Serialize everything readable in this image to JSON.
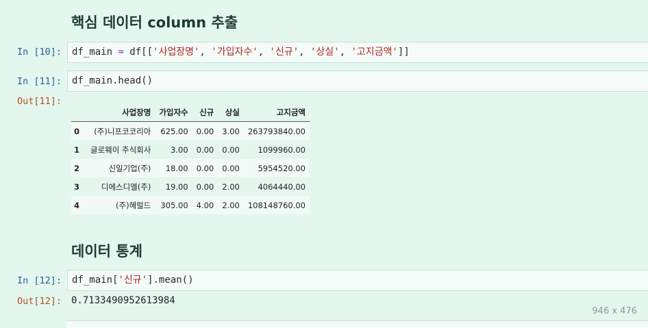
{
  "headings": {
    "extract": "핵심 데이터 column 추출",
    "stats": "데이터 통계"
  },
  "cells": [
    {
      "in_prompt": "In [10]:",
      "code_parts": [
        "df_main ",
        "=",
        " df[[",
        "'사업장명'",
        ", ",
        "'가입자수'",
        ", ",
        "'신규'",
        ", ",
        "'상실'",
        ", ",
        "'고지금액'",
        "]]"
      ]
    },
    {
      "in_prompt": "In [11]:",
      "code": "df_main.head()",
      "out_prompt": "Out[11]:"
    },
    {
      "in_prompt": "In [12]:",
      "code_parts": [
        "df_main[",
        "'신규'",
        "].mean()"
      ],
      "out_prompt": "Out[12]:",
      "output": "0.7133490952613984"
    }
  ],
  "dataframe": {
    "columns": [
      "",
      "사업장명",
      "가입자수",
      "신규",
      "상실",
      "고지금액"
    ],
    "rows": [
      [
        "0",
        "(주)니프코코리아",
        "625.00",
        "0.00",
        "3.00",
        "263793840.00"
      ],
      [
        "1",
        "글로웨이 주식회사",
        "3.00",
        "0.00",
        "0.00",
        "1099960.00"
      ],
      [
        "2",
        "신일기업(주)",
        "18.00",
        "0.00",
        "0.00",
        "5954520.00"
      ],
      [
        "3",
        "디에스디엘(주)",
        "19.00",
        "0.00",
        "2.00",
        "4064440.00"
      ],
      [
        "4",
        "(주)혜럴드",
        "305.00",
        "4.00",
        "2.00",
        "108148760.00"
      ]
    ]
  },
  "overlay": {
    "dimensions": "946 x 476"
  }
}
